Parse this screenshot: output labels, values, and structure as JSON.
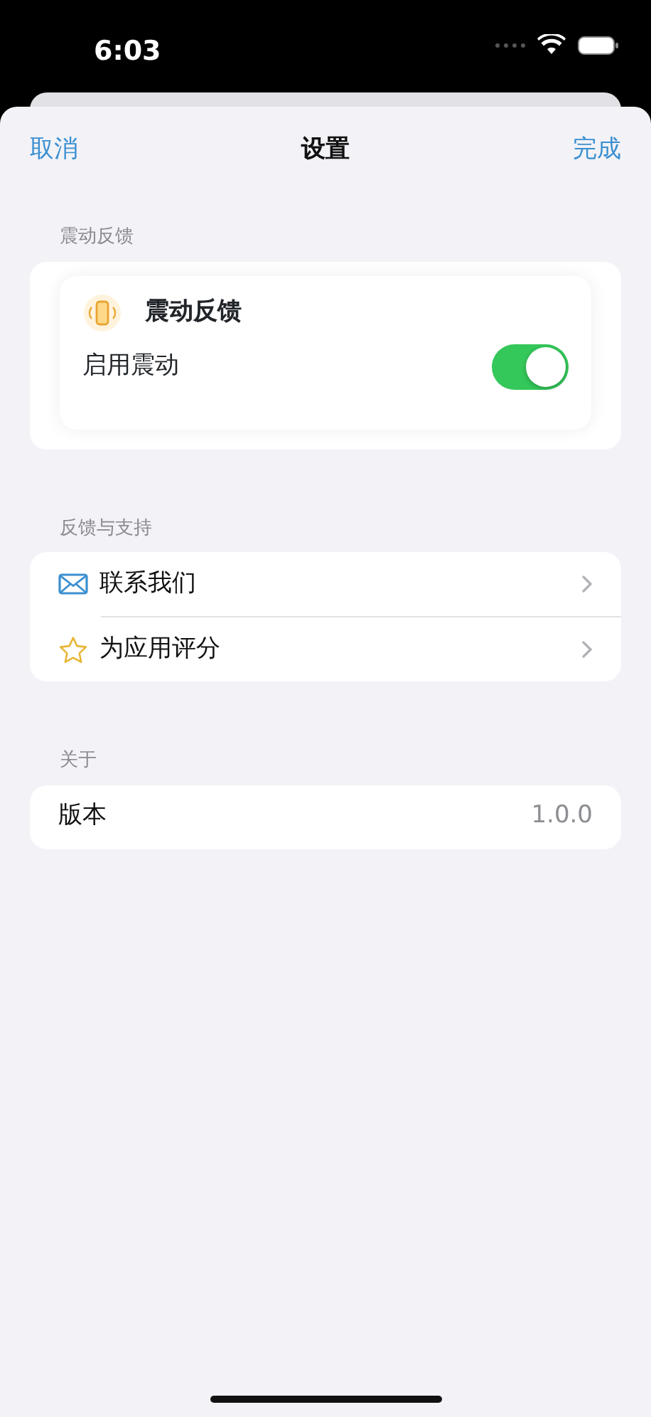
{
  "status_bar": {
    "time": "6:03"
  },
  "nav": {
    "cancel": "取消",
    "title": "设置",
    "done": "完成"
  },
  "sections": [
    {
      "kind": "haptic",
      "header": "震动反馈",
      "card_title": "震动反馈",
      "toggle": {
        "label": "启用震动",
        "on": true
      }
    },
    {
      "kind": "links",
      "header": "反馈与支持",
      "rows": [
        {
          "kind": "mail",
          "label": "联系我们"
        },
        {
          "kind": "star",
          "label": "为应用评分"
        }
      ]
    },
    {
      "kind": "info",
      "header": "关于",
      "rows": [
        {
          "label": "版本",
          "value": "1.0.0"
        }
      ]
    }
  ]
}
